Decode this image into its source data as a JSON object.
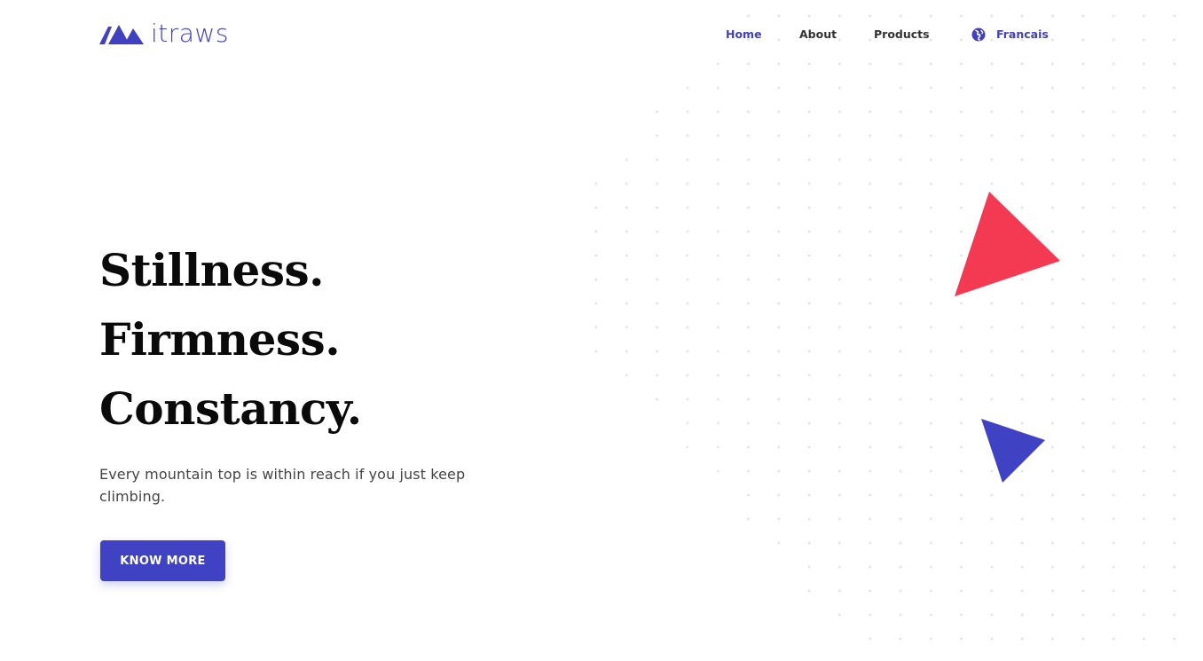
{
  "brand": {
    "name": "itraws",
    "color": "#4040c0"
  },
  "nav": {
    "items": [
      {
        "label": "Home",
        "active": true
      },
      {
        "label": "About",
        "active": false
      },
      {
        "label": "Products",
        "active": false
      }
    ],
    "language": {
      "label": "Francais",
      "icon": "globe-icon"
    }
  },
  "hero": {
    "headline": [
      "Stillness.",
      "Firmness.",
      "Constancy."
    ],
    "subtext": "Every mountain top is within reach if you just keep climbing.",
    "cta_label": "KNOW MORE"
  },
  "colors": {
    "accent": "#3f42c2",
    "triangle_red": "#f33a52",
    "triangle_blue": "#3f42c2",
    "dots": "#e4e4ee"
  }
}
